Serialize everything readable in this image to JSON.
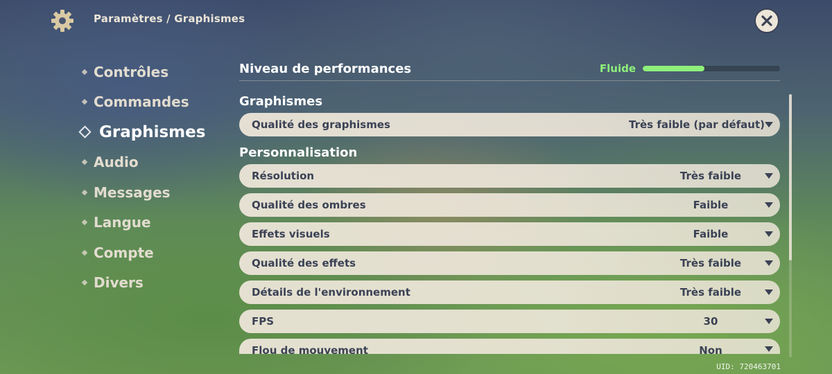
{
  "header": {
    "breadcrumb": "Paramètres / Graphismes"
  },
  "nav": {
    "items": [
      {
        "label": "Contrôles"
      },
      {
        "label": "Commandes"
      },
      {
        "label": "Graphismes",
        "active": true
      },
      {
        "label": "Audio"
      },
      {
        "label": "Messages"
      },
      {
        "label": "Langue"
      },
      {
        "label": "Compte"
      },
      {
        "label": "Divers"
      }
    ]
  },
  "performance": {
    "title": "Niveau de performances",
    "level_label": "Fluide",
    "level_fraction": 0.45
  },
  "sections": {
    "graphics": "Graphismes",
    "custom": "Personnalisation"
  },
  "quality_setting": {
    "label": "Qualité des graphismes",
    "value": "Très faible (par défaut)"
  },
  "settings": [
    {
      "label": "Résolution",
      "value": "Très faible"
    },
    {
      "label": "Qualité des ombres",
      "value": "Faible"
    },
    {
      "label": "Effets visuels",
      "value": "Faible"
    },
    {
      "label": "Qualité des effets",
      "value": "Très faible"
    },
    {
      "label": "Détails de l'environnement",
      "value": "Très faible"
    },
    {
      "label": "FPS",
      "value": "30"
    },
    {
      "label": "Flou de mouvement",
      "value": "Non"
    }
  ],
  "uid": "UID: 720463701",
  "colors": {
    "accent_green": "#8ff07a",
    "row_bg": "#ece5d8",
    "text_dark": "#3b4255"
  }
}
